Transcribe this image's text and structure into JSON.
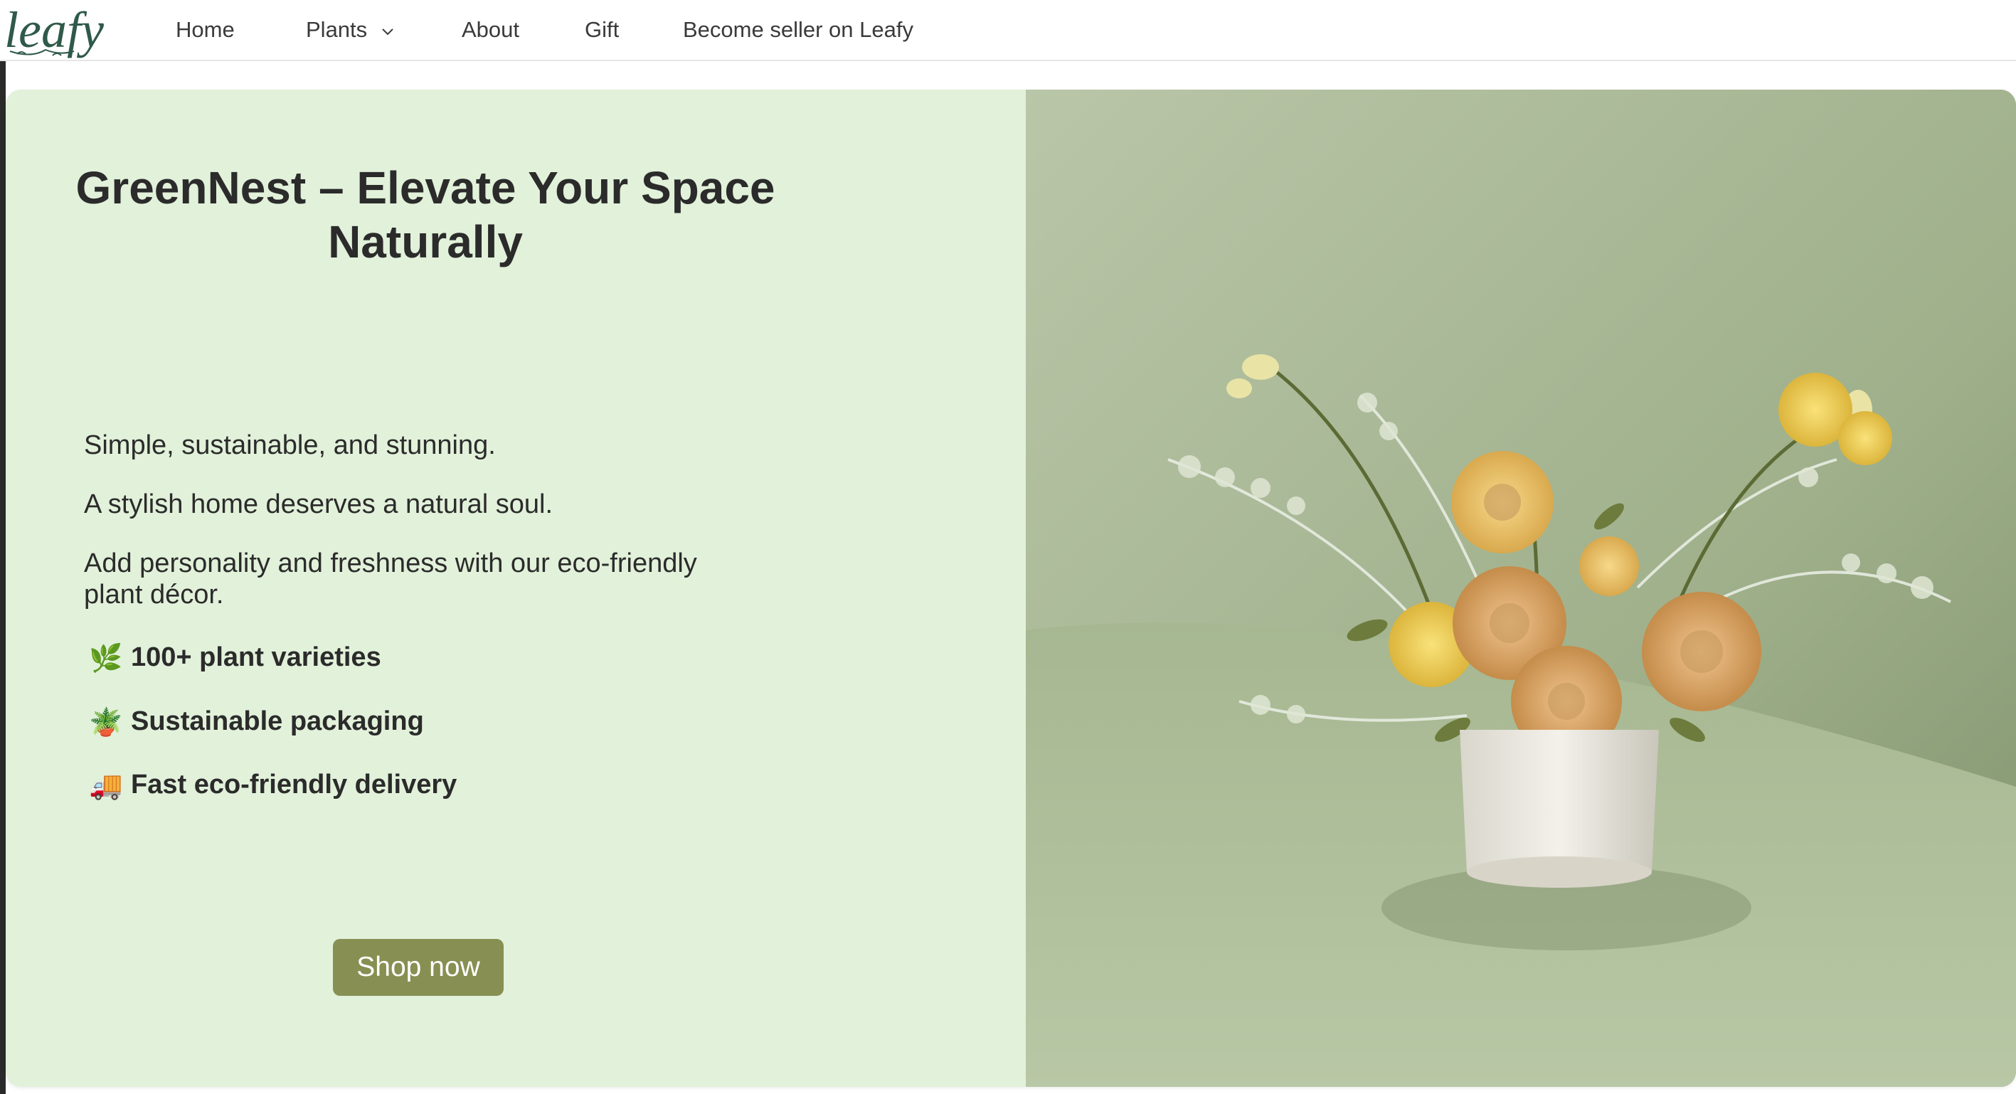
{
  "brand": {
    "logo_text": "leafy"
  },
  "nav": {
    "home": "Home",
    "plants": "Plants",
    "about": "About",
    "gift": "Gift",
    "seller": "Become seller on Leafy"
  },
  "hero": {
    "title": "GreenNest – Elevate Your Space Naturally",
    "paragraphs": [
      "Simple, sustainable, and stunning.",
      "A stylish home deserves a natural soul.",
      "Add personality and freshness with our eco-friendly plant décor."
    ],
    "features": [
      {
        "icon": "herb-icon",
        "emoji": "🌿",
        "label": "100+ plant varieties"
      },
      {
        "icon": "potted-plant-icon",
        "emoji": "🪴",
        "label": "Sustainable packaging"
      },
      {
        "icon": "delivery-truck-icon",
        "emoji": "🚚",
        "label": "Fast eco-friendly delivery"
      }
    ],
    "cta": "Shop now",
    "image_subject": "flower-arrangement-image"
  },
  "colors": {
    "hero_bg": "#e2f1da",
    "cta_bg": "#879052",
    "logo_green": "#2f5a4a",
    "image_bg": "#a7b895"
  }
}
